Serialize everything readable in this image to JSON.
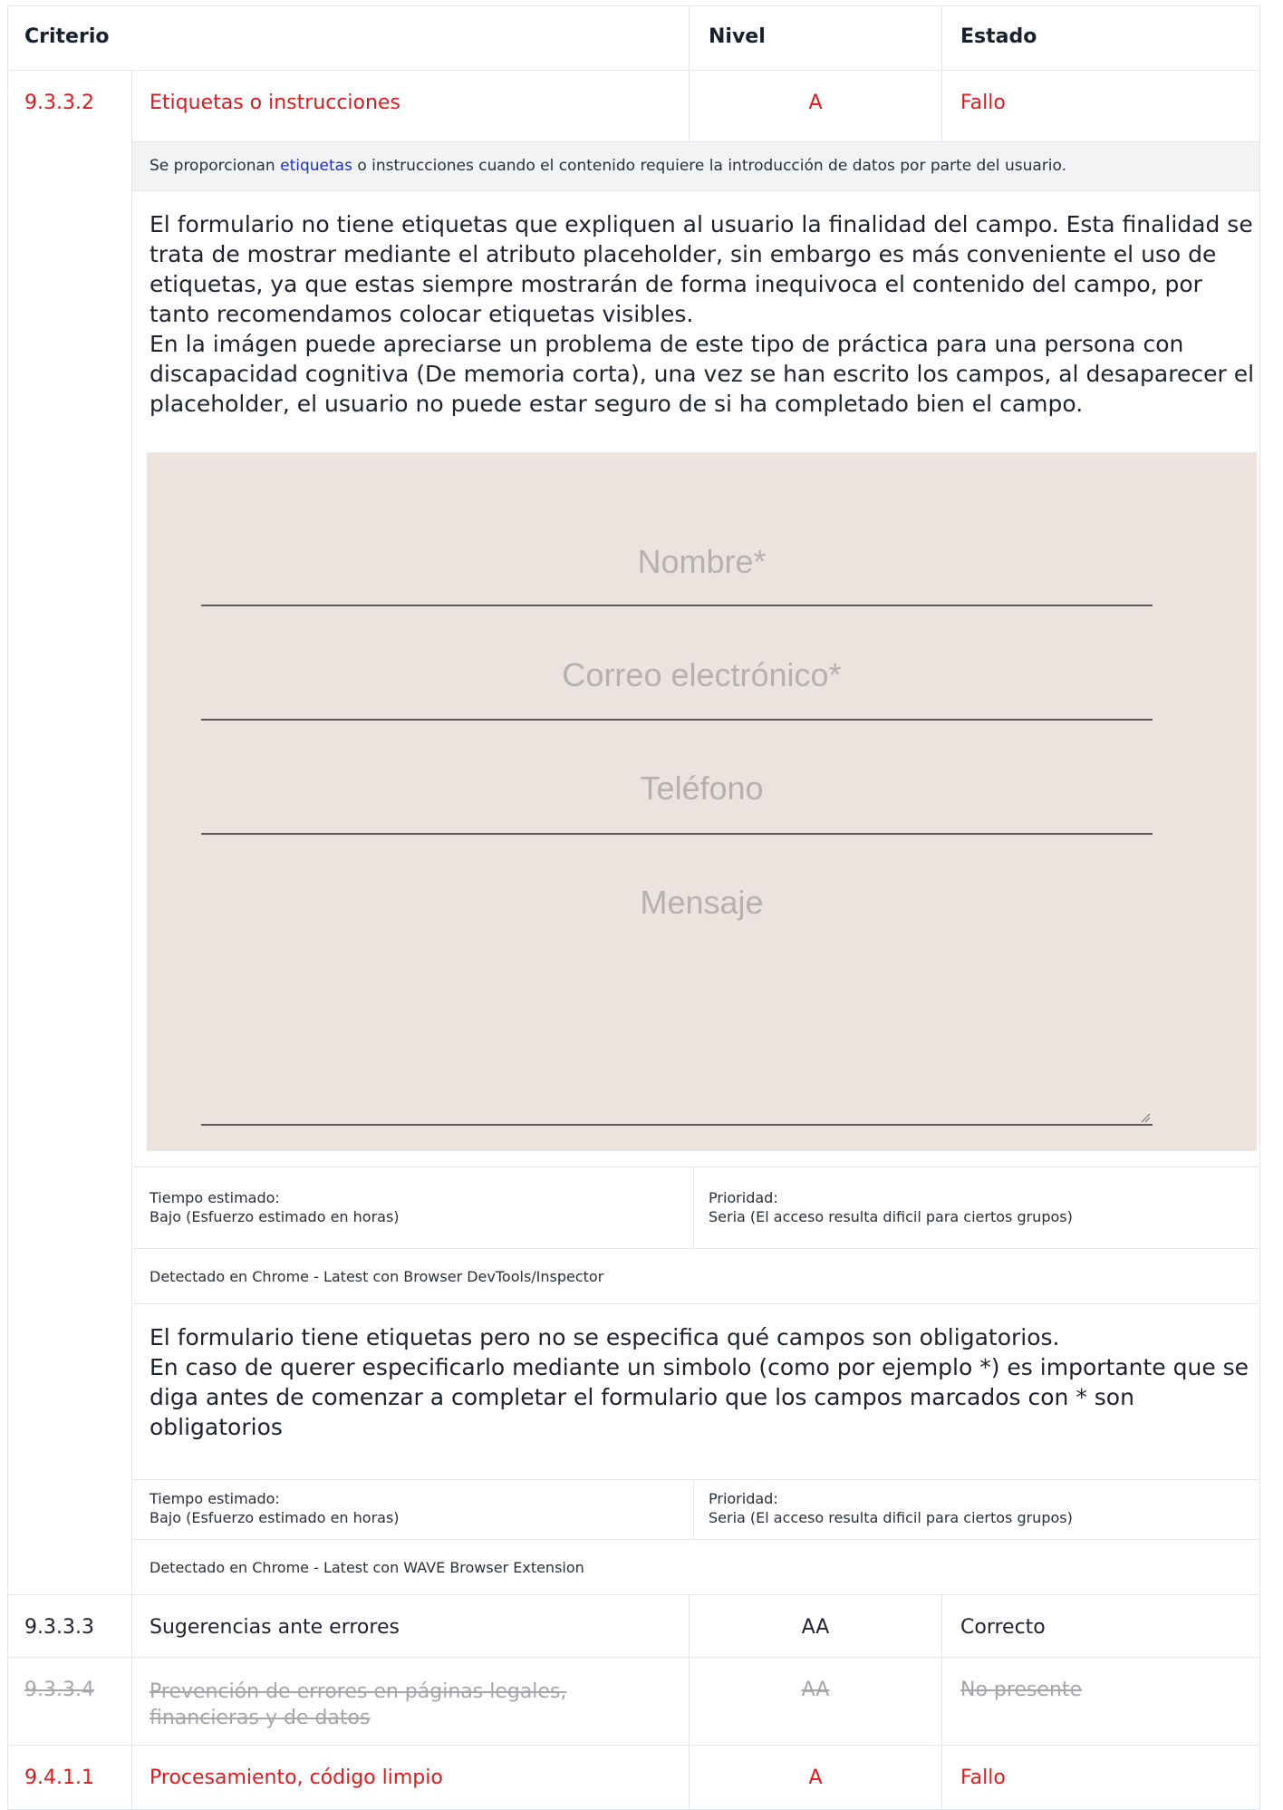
{
  "header": {
    "criterio": "Criterio",
    "nivel": "Nivel",
    "estado": "Estado"
  },
  "rows": [
    {
      "id": "9.3.3.2",
      "name": "Etiquetas o instrucciones",
      "level": "A",
      "status": "Fallo"
    },
    {
      "id": "9.3.3.3",
      "name": "Sugerencias ante errores",
      "level": "AA",
      "status": "Correcto"
    },
    {
      "id": "9.3.3.4",
      "name": "Prevención de errores en páginas legales, financieras y de datos",
      "level": "AA",
      "status": "No presente"
    },
    {
      "id": "9.4.1.1",
      "name": "Procesamiento, código limpio",
      "level": "A",
      "status": "Fallo"
    }
  ],
  "description": {
    "before": "Se proporcionan ",
    "link": "etiquetas",
    "after": " o instrucciones cuando el contenido requiere la introducción de datos por parte del usuario."
  },
  "issue1": {
    "text_p1": "El formulario no tiene etiquetas que expliquen al usuario la finalidad del campo. Esta finalidad se trata de mostrar mediante el atributo placeholder, sin embargo es más conveniente el uso de etiquetas, ya que estas siempre mostrarán de forma inequivoca el contenido del campo, por tanto recomendamos colocar etiquetas visibles.",
    "text_p2": "En la imágen puede apreciarse un problema de este tipo de práctica para una persona con discapacidad cognitiva (De memoria corta), una vez se han escrito los campos, al desaparecer el placeholder, el usuario no puede estar seguro de si ha completado bien el campo.",
    "form": {
      "name_placeholder": "Nombre*",
      "email_placeholder": "Correo electrónico*",
      "phone_placeholder": "Teléfono",
      "message_placeholder": "Mensaje"
    },
    "time_label": "Tiempo estimado:",
    "time_value": "Bajo (Esfuerzo estimado en horas)",
    "priority_label": "Prioridad:",
    "priority_value": "Seria (El acceso resulta dificil para ciertos grupos)",
    "detected": "Detectado en Chrome - Latest con Browser DevTools/Inspector"
  },
  "issue2": {
    "text_p1": "El formulario tiene etiquetas pero no se especifica qué campos son obligatorios.",
    "text_p2": "En caso de querer especificarlo mediante un simbolo (como por ejemplo *) es importante que se diga antes de comenzar a completar el formulario que los campos marcados con * son obligatorios",
    "time_label": "Tiempo estimado:",
    "time_value": "Bajo (Esfuerzo estimado en horas)",
    "priority_label": "Prioridad:",
    "priority_value": "Seria (El acceso resulta dificil para ciertos grupos)",
    "detected": "Detectado en Chrome - Latest con WAVE Browser Extension"
  },
  "colors": {
    "fail": "#e0191c",
    "muted": "#a3a6ab",
    "desc_bg": "#f1f3f5",
    "form_bg": "#ece3df"
  }
}
